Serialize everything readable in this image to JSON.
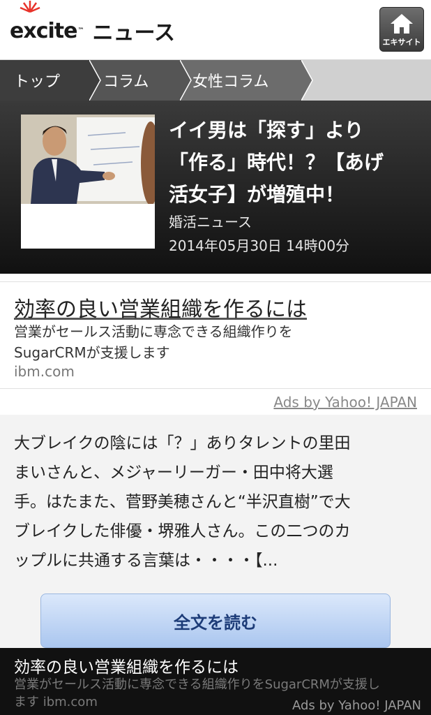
{
  "header": {
    "logo_text": "excite",
    "logo_tm": "™",
    "title": "ニュース",
    "home_label": "エキサイト",
    "home_icon": "house-icon"
  },
  "breadcrumb": [
    {
      "label": "トップ"
    },
    {
      "label": "コラム"
    },
    {
      "label": "女性コラム"
    }
  ],
  "feature": {
    "title_lines": [
      "イイ男は「探す」より",
      "「作る」時代！？【あげ",
      "活女子】が増殖中！"
    ],
    "source": "婚活ニュース",
    "date": "2014年05月30日 14時00分"
  },
  "ad": {
    "title": "効率の良い営業組織を作るには",
    "desc_lines": [
      "営業がセールス活動に専念できる組織作りを",
      "SugarCRMが支援します"
    ],
    "domain": "ibm.com",
    "ads_by": "Ads by Yahoo! JAPAN"
  },
  "article": {
    "lines": [
      "大ブレイクの陰には「？」ありタレントの里田",
      "まいさんと、メジャーリーガー・田中将大選",
      "手。はたまた、菅野美穂さんと“半沢直樹”で大",
      "ブレイクした俳優・堺雅人さん。この二つのカ",
      "ップルに共通する言葉は・・・・【..."
    ],
    "read_more": "全文を読む"
  },
  "bottom_ad": {
    "title": "効率の良い営業組織を作るには",
    "desc_lines": [
      "営業がセールス活動に専念できる組織作りをSugarCRMが支援し",
      "ます ibm.com"
    ],
    "ads_by": "Ads by Yahoo! JAPAN"
  },
  "colors": {
    "brand_red": "#e8332a",
    "button_text": "#1d3c78"
  }
}
